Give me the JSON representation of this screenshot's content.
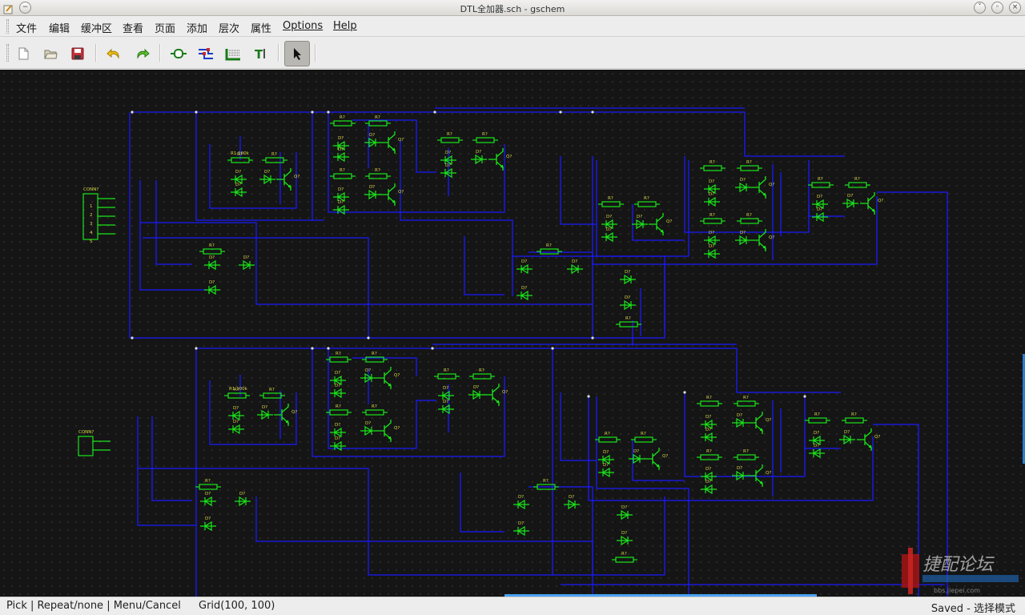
{
  "window": {
    "title": "DTL全加器.sch - gschem"
  },
  "menu": [
    {
      "label": "文件"
    },
    {
      "label": "编辑"
    },
    {
      "label": "缓冲区"
    },
    {
      "label": "查看"
    },
    {
      "label": "页面"
    },
    {
      "label": "添加"
    },
    {
      "label": "层次"
    },
    {
      "label": "属性"
    },
    {
      "label": "Options"
    },
    {
      "label": "Help"
    }
  ],
  "toolbar": [
    {
      "icon": "new-file-icon"
    },
    {
      "icon": "open-folder-icon"
    },
    {
      "icon": "save-icon"
    },
    {
      "icon": "undo-icon"
    },
    {
      "icon": "redo-icon"
    },
    {
      "icon": "add-component-icon"
    },
    {
      "icon": "add-net-icon"
    },
    {
      "icon": "add-bus-icon"
    },
    {
      "icon": "add-text-icon"
    },
    {
      "icon": "select-pointer-icon",
      "active": true
    }
  ],
  "schematic": {
    "labels": {
      "connector": "CONN?",
      "resistor": "R?",
      "resistor_named": "R1 100k",
      "diode": "D?",
      "transistor": "Q?"
    },
    "colors": {
      "background": "#151515",
      "net": "#1a1aff",
      "component": "#19e619",
      "label": "#d9d94a"
    }
  },
  "watermark": {
    "text": "捷配论坛",
    "url": "bbs.jiepei.com"
  },
  "status": {
    "mouse_hint": "Pick | Repeat/none | Menu/Cancel",
    "grid": "Grid(100, 100)",
    "state": "Saved - 选择模式"
  }
}
